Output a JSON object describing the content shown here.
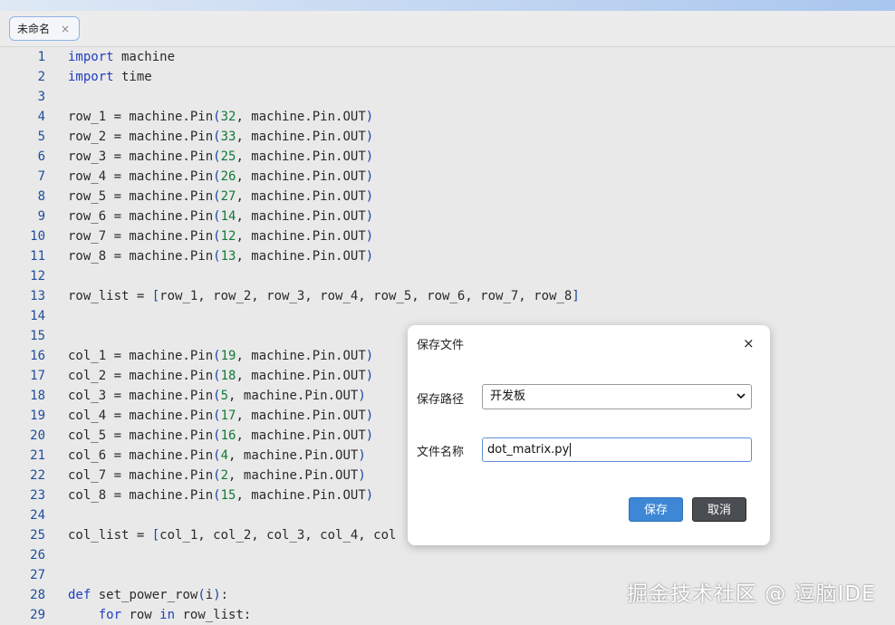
{
  "window": {
    "accent_strip_colors": [
      "#dfe9f5",
      "#a9c6ee"
    ]
  },
  "tabs": [
    {
      "label": "未命名",
      "close": "×",
      "active": true
    }
  ],
  "editor": {
    "lines": [
      {
        "n": "1",
        "tokens": [
          {
            "t": "import",
            "c": "kw"
          },
          {
            "t": " machine"
          }
        ]
      },
      {
        "n": "2",
        "tokens": [
          {
            "t": "import",
            "c": "kw"
          },
          {
            "t": " time"
          }
        ]
      },
      {
        "n": "3",
        "tokens": []
      },
      {
        "n": "4",
        "tokens": [
          {
            "t": "row_1 = machine.Pin"
          },
          {
            "t": "(",
            "c": "p"
          },
          {
            "t": "32",
            "c": "num"
          },
          {
            "t": ", machine.Pin.OUT"
          },
          {
            "t": ")",
            "c": "p"
          }
        ]
      },
      {
        "n": "5",
        "tokens": [
          {
            "t": "row_2 = machine.Pin"
          },
          {
            "t": "(",
            "c": "p"
          },
          {
            "t": "33",
            "c": "num"
          },
          {
            "t": ", machine.Pin.OUT"
          },
          {
            "t": ")",
            "c": "p"
          }
        ]
      },
      {
        "n": "6",
        "tokens": [
          {
            "t": "row_3 = machine.Pin"
          },
          {
            "t": "(",
            "c": "p"
          },
          {
            "t": "25",
            "c": "num"
          },
          {
            "t": ", machine.Pin.OUT"
          },
          {
            "t": ")",
            "c": "p"
          }
        ]
      },
      {
        "n": "7",
        "tokens": [
          {
            "t": "row_4 = machine.Pin"
          },
          {
            "t": "(",
            "c": "p"
          },
          {
            "t": "26",
            "c": "num"
          },
          {
            "t": ", machine.Pin.OUT"
          },
          {
            "t": ")",
            "c": "p"
          }
        ]
      },
      {
        "n": "8",
        "tokens": [
          {
            "t": "row_5 = machine.Pin"
          },
          {
            "t": "(",
            "c": "p"
          },
          {
            "t": "27",
            "c": "num"
          },
          {
            "t": ", machine.Pin.OUT"
          },
          {
            "t": ")",
            "c": "p"
          }
        ]
      },
      {
        "n": "9",
        "tokens": [
          {
            "t": "row_6 = machine.Pin"
          },
          {
            "t": "(",
            "c": "p"
          },
          {
            "t": "14",
            "c": "num"
          },
          {
            "t": ", machine.Pin.OUT"
          },
          {
            "t": ")",
            "c": "p"
          }
        ]
      },
      {
        "n": "10",
        "tokens": [
          {
            "t": "row_7 = machine.Pin"
          },
          {
            "t": "(",
            "c": "p"
          },
          {
            "t": "12",
            "c": "num"
          },
          {
            "t": ", machine.Pin.OUT"
          },
          {
            "t": ")",
            "c": "p"
          }
        ]
      },
      {
        "n": "11",
        "tokens": [
          {
            "t": "row_8 = machine.Pin"
          },
          {
            "t": "(",
            "c": "p"
          },
          {
            "t": "13",
            "c": "num"
          },
          {
            "t": ", machine.Pin.OUT"
          },
          {
            "t": ")",
            "c": "p"
          }
        ]
      },
      {
        "n": "12",
        "tokens": []
      },
      {
        "n": "13",
        "tokens": [
          {
            "t": "row_list = "
          },
          {
            "t": "[",
            "c": "p"
          },
          {
            "t": "row_1, row_2, row_3, row_4, row_5, row_6, row_7, row_8"
          },
          {
            "t": "]",
            "c": "p"
          }
        ]
      },
      {
        "n": "14",
        "tokens": []
      },
      {
        "n": "15",
        "tokens": []
      },
      {
        "n": "16",
        "tokens": [
          {
            "t": "col_1 = machine.Pin"
          },
          {
            "t": "(",
            "c": "p"
          },
          {
            "t": "19",
            "c": "num"
          },
          {
            "t": ", machine.Pin.OUT"
          },
          {
            "t": ")",
            "c": "p"
          }
        ]
      },
      {
        "n": "17",
        "tokens": [
          {
            "t": "col_2 = machine.Pin"
          },
          {
            "t": "(",
            "c": "p"
          },
          {
            "t": "18",
            "c": "num"
          },
          {
            "t": ", machine.Pin.OUT"
          },
          {
            "t": ")",
            "c": "p"
          }
        ]
      },
      {
        "n": "18",
        "tokens": [
          {
            "t": "col_3 = machine.Pin"
          },
          {
            "t": "(",
            "c": "p"
          },
          {
            "t": "5",
            "c": "num"
          },
          {
            "t": ", machine.Pin.OUT"
          },
          {
            "t": ")",
            "c": "p"
          }
        ]
      },
      {
        "n": "19",
        "tokens": [
          {
            "t": "col_4 = machine.Pin"
          },
          {
            "t": "(",
            "c": "p"
          },
          {
            "t": "17",
            "c": "num"
          },
          {
            "t": ", machine.Pin.OUT"
          },
          {
            "t": ")",
            "c": "p"
          }
        ]
      },
      {
        "n": "20",
        "tokens": [
          {
            "t": "col_5 = machine.Pin"
          },
          {
            "t": "(",
            "c": "p"
          },
          {
            "t": "16",
            "c": "num"
          },
          {
            "t": ", machine.Pin.OUT"
          },
          {
            "t": ")",
            "c": "p"
          }
        ]
      },
      {
        "n": "21",
        "tokens": [
          {
            "t": "col_6 = machine.Pin"
          },
          {
            "t": "(",
            "c": "p"
          },
          {
            "t": "4",
            "c": "num"
          },
          {
            "t": ", machine.Pin.OUT"
          },
          {
            "t": ")",
            "c": "p"
          }
        ]
      },
      {
        "n": "22",
        "tokens": [
          {
            "t": "col_7 = machine.Pin"
          },
          {
            "t": "(",
            "c": "p"
          },
          {
            "t": "2",
            "c": "num"
          },
          {
            "t": ", machine.Pin.OUT"
          },
          {
            "t": ")",
            "c": "p"
          }
        ]
      },
      {
        "n": "23",
        "tokens": [
          {
            "t": "col_8 = machine.Pin"
          },
          {
            "t": "(",
            "c": "p"
          },
          {
            "t": "15",
            "c": "num"
          },
          {
            "t": ", machine.Pin.OUT"
          },
          {
            "t": ")",
            "c": "p"
          }
        ]
      },
      {
        "n": "24",
        "tokens": []
      },
      {
        "n": "25",
        "tokens": [
          {
            "t": "col_list = "
          },
          {
            "t": "[",
            "c": "p"
          },
          {
            "t": "col_1, col_2, col_3, col_4, col"
          }
        ]
      },
      {
        "n": "26",
        "tokens": []
      },
      {
        "n": "27",
        "tokens": []
      },
      {
        "n": "28",
        "tokens": [
          {
            "t": "def",
            "c": "kw"
          },
          {
            "t": " set_power_row"
          },
          {
            "t": "(",
            "c": "p"
          },
          {
            "t": "i"
          },
          {
            "t": ")",
            "c": "p"
          },
          {
            "t": ":"
          }
        ]
      },
      {
        "n": "29",
        "tokens": [
          {
            "t": "    "
          },
          {
            "t": "for",
            "c": "kw"
          },
          {
            "t": " row "
          },
          {
            "t": "in",
            "c": "kw"
          },
          {
            "t": " row_list:"
          }
        ]
      }
    ]
  },
  "save_dialog": {
    "title": "保存文件",
    "close": "×",
    "path_label": "保存路径",
    "path_value": "开发板",
    "name_label": "文件名称",
    "name_value": "dot_matrix.py",
    "save_button": "保存",
    "cancel_button": "取消",
    "save_color": "#3d87d6",
    "cancel_color": "#4a4d51"
  },
  "watermark": "掘金技术社区 @ 逗脑IDE"
}
